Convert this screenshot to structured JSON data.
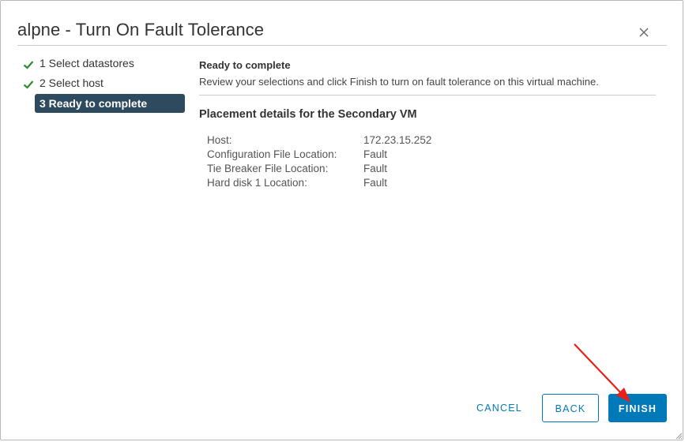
{
  "dialog": {
    "title": "alpne - Turn On Fault Tolerance",
    "close_icon": "close-icon"
  },
  "steps": [
    {
      "label": "1 Select datastores",
      "state": "complete"
    },
    {
      "label": "2 Select host",
      "state": "complete"
    },
    {
      "label": "3 Ready to complete",
      "state": "active"
    }
  ],
  "content": {
    "section_title": "Ready to complete",
    "section_desc": "Review your selections and click Finish to turn on fault tolerance on this virtual machine.",
    "placement_title": "Placement details for the Secondary VM",
    "details": [
      {
        "label": "Host:",
        "value": "172.23.15.252"
      },
      {
        "label": "Configuration File Location:",
        "value": "Fault"
      },
      {
        "label": "Tie Breaker File Location:",
        "value": "Fault"
      },
      {
        "label": "Hard disk 1 Location:",
        "value": "Fault"
      }
    ]
  },
  "footer": {
    "cancel_label": "CANCEL",
    "back_label": "BACK",
    "finish_label": "FINISH"
  },
  "colors": {
    "accent": "#0079b8",
    "active_step_bg": "#2e4a5e",
    "check": "#2e8b2e",
    "annotation_arrow": "#e8201a"
  }
}
